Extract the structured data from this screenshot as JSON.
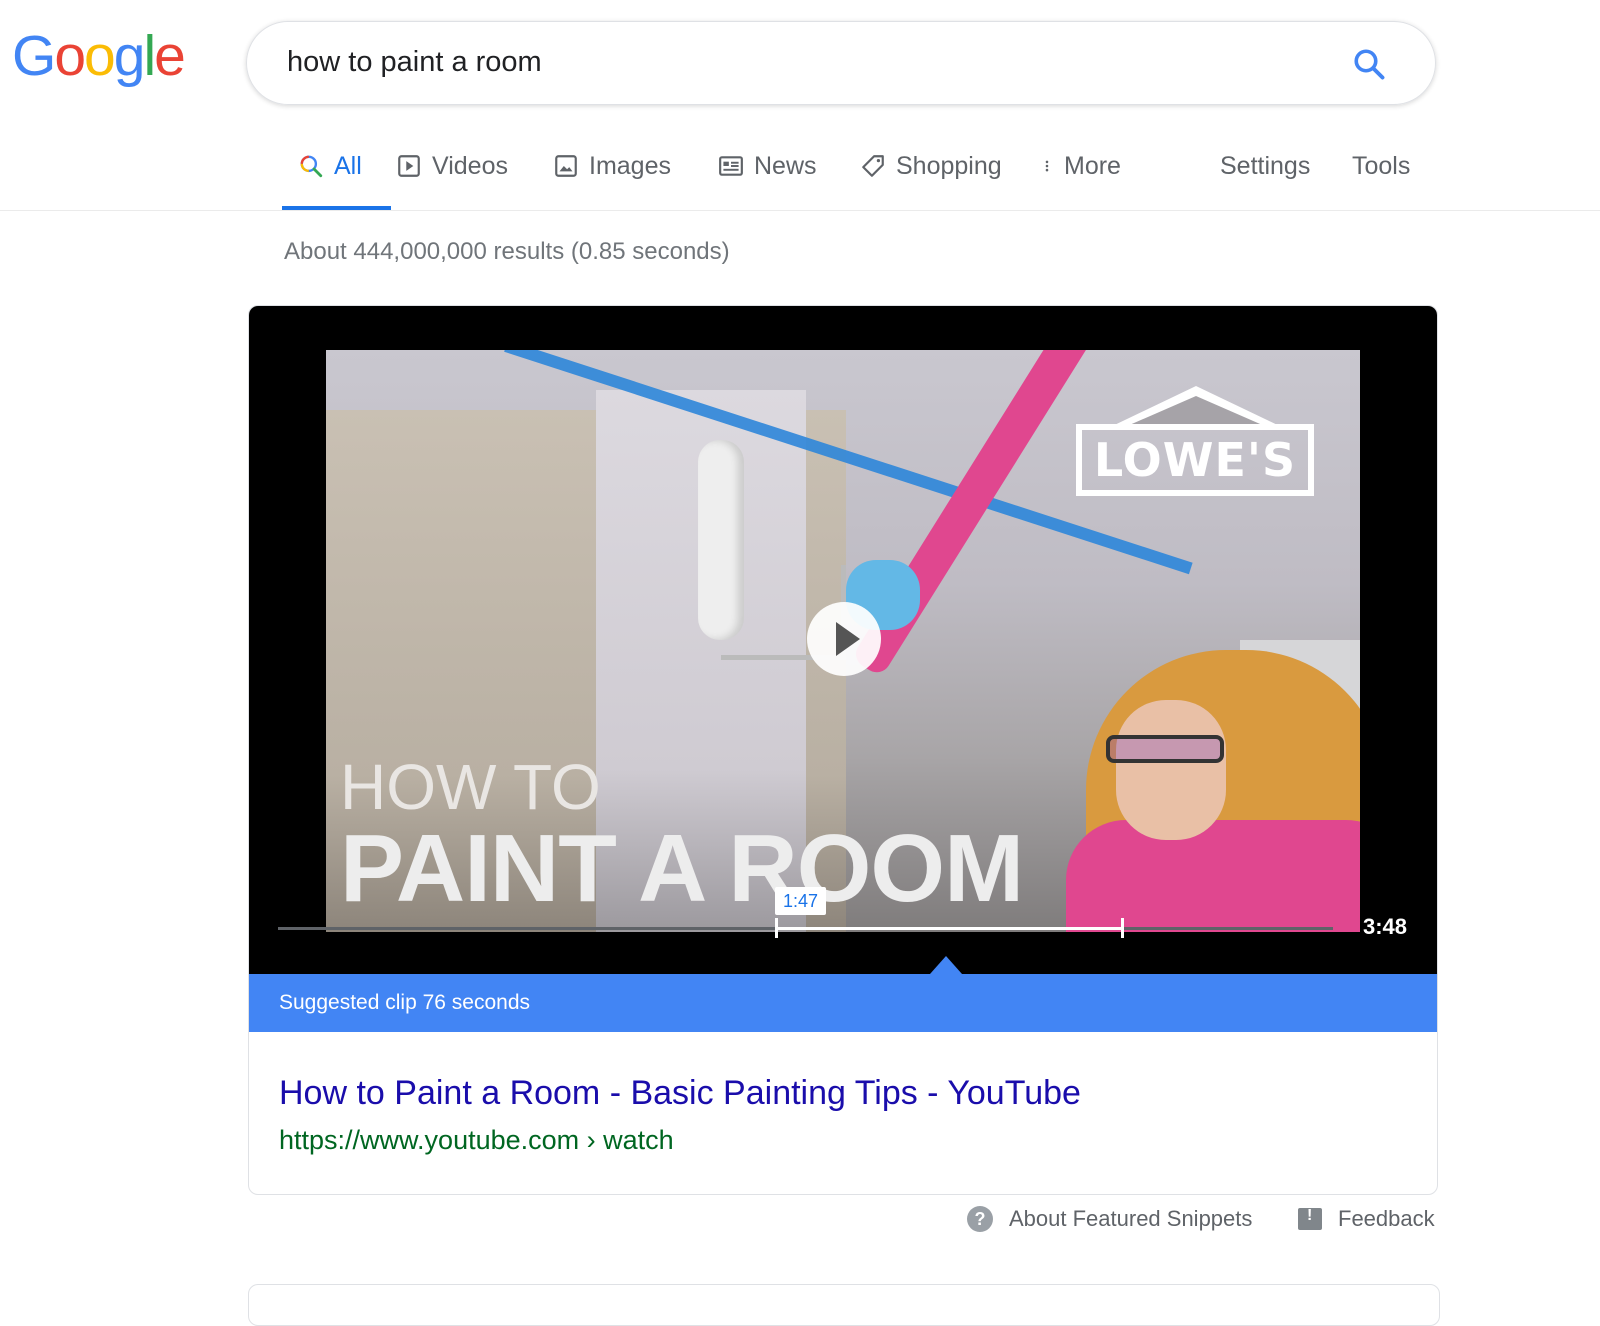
{
  "logo": {
    "letters": [
      "G",
      "o",
      "o",
      "g",
      "l",
      "e"
    ],
    "colors": [
      "#4285f4",
      "#ea4335",
      "#fbbc05",
      "#4285f4",
      "#34a853",
      "#ea4335"
    ]
  },
  "search": {
    "query": "how to paint a room"
  },
  "tabs": [
    {
      "label": "All",
      "icon": "search-icon"
    },
    {
      "label": "Videos",
      "icon": "play-box-icon"
    },
    {
      "label": "Images",
      "icon": "image-icon"
    },
    {
      "label": "News",
      "icon": "news-icon"
    },
    {
      "label": "Shopping",
      "icon": "tag-icon"
    },
    {
      "label": "More",
      "icon": "vertical-dots-icon"
    }
  ],
  "tools": {
    "settings": "Settings",
    "tools": "Tools"
  },
  "stats": "About 444,000,000 results (0.85 seconds)",
  "video": {
    "brand": "LOWE'S",
    "overlay_line1": "HOW TO",
    "overlay_line2": "PAINT A ROOM",
    "clip_start": "1:47",
    "duration": "3:48",
    "clip_banner": "Suggested clip 76 seconds"
  },
  "result": {
    "title": "How to Paint a Room - Basic Painting Tips - YouTube",
    "url": "https://www.youtube.com › watch"
  },
  "footer": {
    "about": "About Featured Snippets",
    "feedback": "Feedback"
  },
  "colors": {
    "accent": "#1a73e8",
    "link": "#1a0dab",
    "url": "#006621",
    "clip_bar": "#4285f4"
  }
}
